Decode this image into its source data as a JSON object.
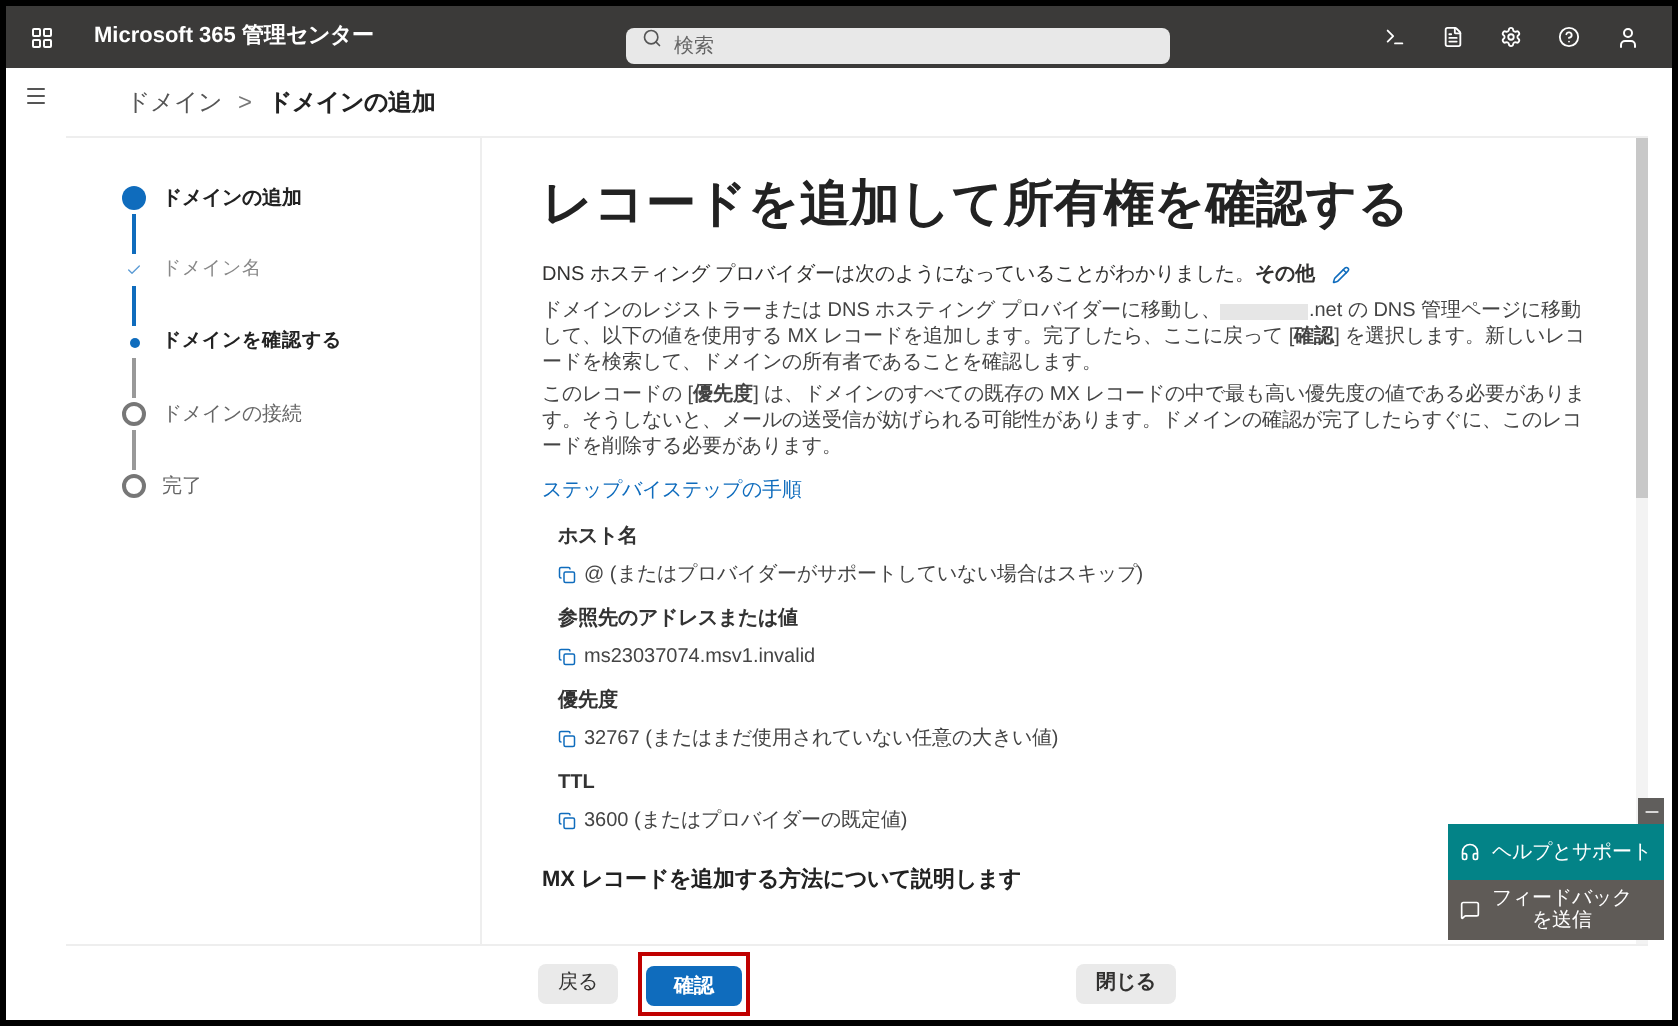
{
  "topbar": {
    "app_title": "Microsoft 365 管理センター",
    "search": {
      "placeholder": "検索"
    }
  },
  "breadcrumb": [
    {
      "label": "ドメイン",
      "current": false
    },
    {
      "label": "ドメインの追加",
      "current": true
    }
  ],
  "breadcrumb_separator": ">",
  "steps": [
    {
      "label": "ドメインの追加",
      "kind": "major",
      "completed": false,
      "selected": true
    },
    {
      "label": "ドメイン名",
      "kind": "minor",
      "completed": true,
      "selected": false
    },
    {
      "label": "ドメインを確認する",
      "kind": "minor",
      "completed": false,
      "selected": true
    },
    {
      "label": "ドメインの接続",
      "kind": "major",
      "completed": false,
      "selected": false
    },
    {
      "label": "完了",
      "kind": "major",
      "completed": false,
      "selected": false
    }
  ],
  "heading": "レコードを追加して所有権を確認する",
  "provider_line": "DNS ホスティング プロバイダーは次のようになっていることがわかりました。**その他**",
  "instructions_before": "ドメインのレジストラーまたは DNS ホスティング プロバイダーに移動し、",
  "instructions_after": ".net の DNS 管理ページに移動して、以下の値を使用する MX レコードを追加します。完了したら、ここに戻って [**確認**] を選択します。新しいレコードを検索して、ドメインの所有者であることを確認します。",
  "priority_note": "このレコードの [**優先度**] は、ドメインのすべての既存の MX レコードの中で最も高い優先度の値である必要があります。そうしないと、メールの送受信が妨げられる可能性があります。ドメインの確認が完了したらすぐに、このレコードを削除する必要があります。",
  "steps_link": "ステップバイステップの手順",
  "records": [
    {
      "label": "ホスト名",
      "value": "@ (またはプロバイダーがサポートしていない場合はスキップ)"
    },
    {
      "label": "参照先のアドレスまたは値",
      "value": "ms23037074.msv1.invalid"
    },
    {
      "label": "優先度",
      "value": "32767 (またはまだ使用されていない任意の大きい値)"
    },
    {
      "label": "TTL",
      "value": "3600 (またはプロバイダーの既定値)"
    }
  ],
  "section_heading": "MX レコードを追加する方法について説明します",
  "footer": {
    "back": "戻る",
    "confirm": "確認",
    "close": "閉じる"
  },
  "help_panel": {
    "help": "ヘルプとサポート",
    "feedback": [
      "フィードバック",
      "を送信"
    ]
  }
}
